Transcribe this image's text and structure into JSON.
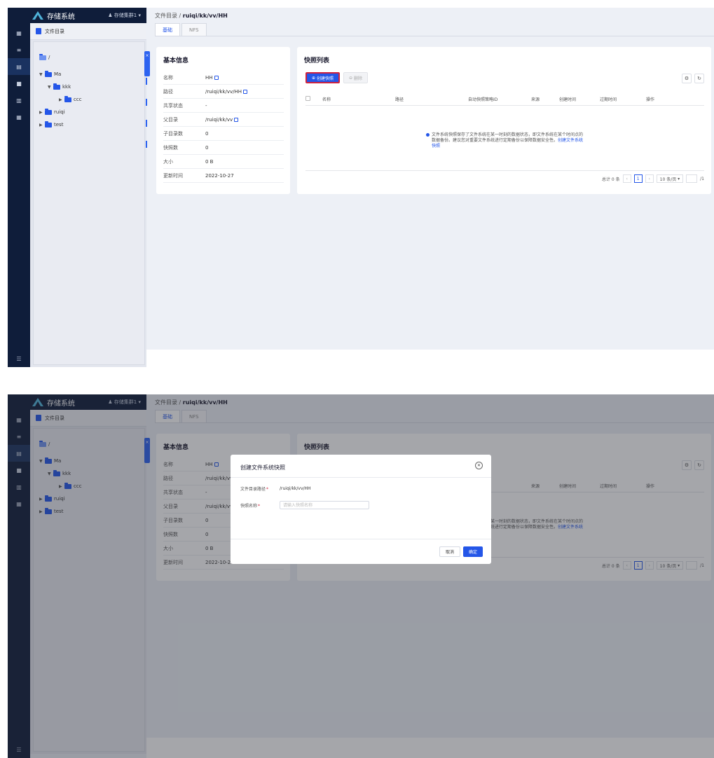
{
  "app": {
    "title": "存储系统",
    "system_selector": "存储集群1",
    "tree_title": "文件目录"
  },
  "tree": {
    "root": "/",
    "items": [
      "Ma",
      "kkk",
      "ccc",
      "ruiqi",
      "test"
    ]
  },
  "breadcrumb": {
    "prefix": "文件目录 / ",
    "path": "ruiqi/kk/vv/HH"
  },
  "tabs": [
    "基础",
    "NFS"
  ],
  "basic_info": {
    "title": "基本信息",
    "rows": [
      {
        "key": "名称",
        "value": "HH"
      },
      {
        "key": "路径",
        "value": "/ruiqi/kk/vv/HH"
      },
      {
        "key": "共享状态",
        "value": "-"
      },
      {
        "key": "父目录",
        "value": "/ruiqi/kk/vv"
      },
      {
        "key": "子目录数",
        "value": "0"
      },
      {
        "key": "快照数",
        "value": "0"
      },
      {
        "key": "大小",
        "value": "0 B"
      },
      {
        "key": "更新时间",
        "value": "2022-10-27"
      }
    ]
  },
  "snapshots": {
    "title": "快照列表",
    "create_label": "创建快照",
    "delete_label": "删除",
    "columns": [
      "名称",
      "路径",
      "自动快照策略ID",
      "来源",
      "创建时间",
      "过期时间",
      "操作"
    ],
    "empty_text": "文件系统快照保存了文件系统在某一时刻的数据状态，即文件系统在某个时间点的数据备份。建议您对重要文件系统进行定期备份以保障数据安全性。",
    "empty_link": "创建文件系统快照",
    "pagination": {
      "total": "总计 0 条",
      "page": "1",
      "page_size": "10 条/页",
      "page_count": "/1"
    }
  },
  "dialog": {
    "title": "创建文件系统快照",
    "dir_label": "文件目录路径",
    "dir_value": "/ruiqi/kk/vv/HH",
    "name_label": "快照名称",
    "name_placeholder": "请输入快照名称",
    "cancel_label": "取消",
    "ok_label": "确定"
  },
  "colors": {
    "nav": "#0f1d3a",
    "accent": "#2456e8",
    "highlight": "#d0213c"
  }
}
